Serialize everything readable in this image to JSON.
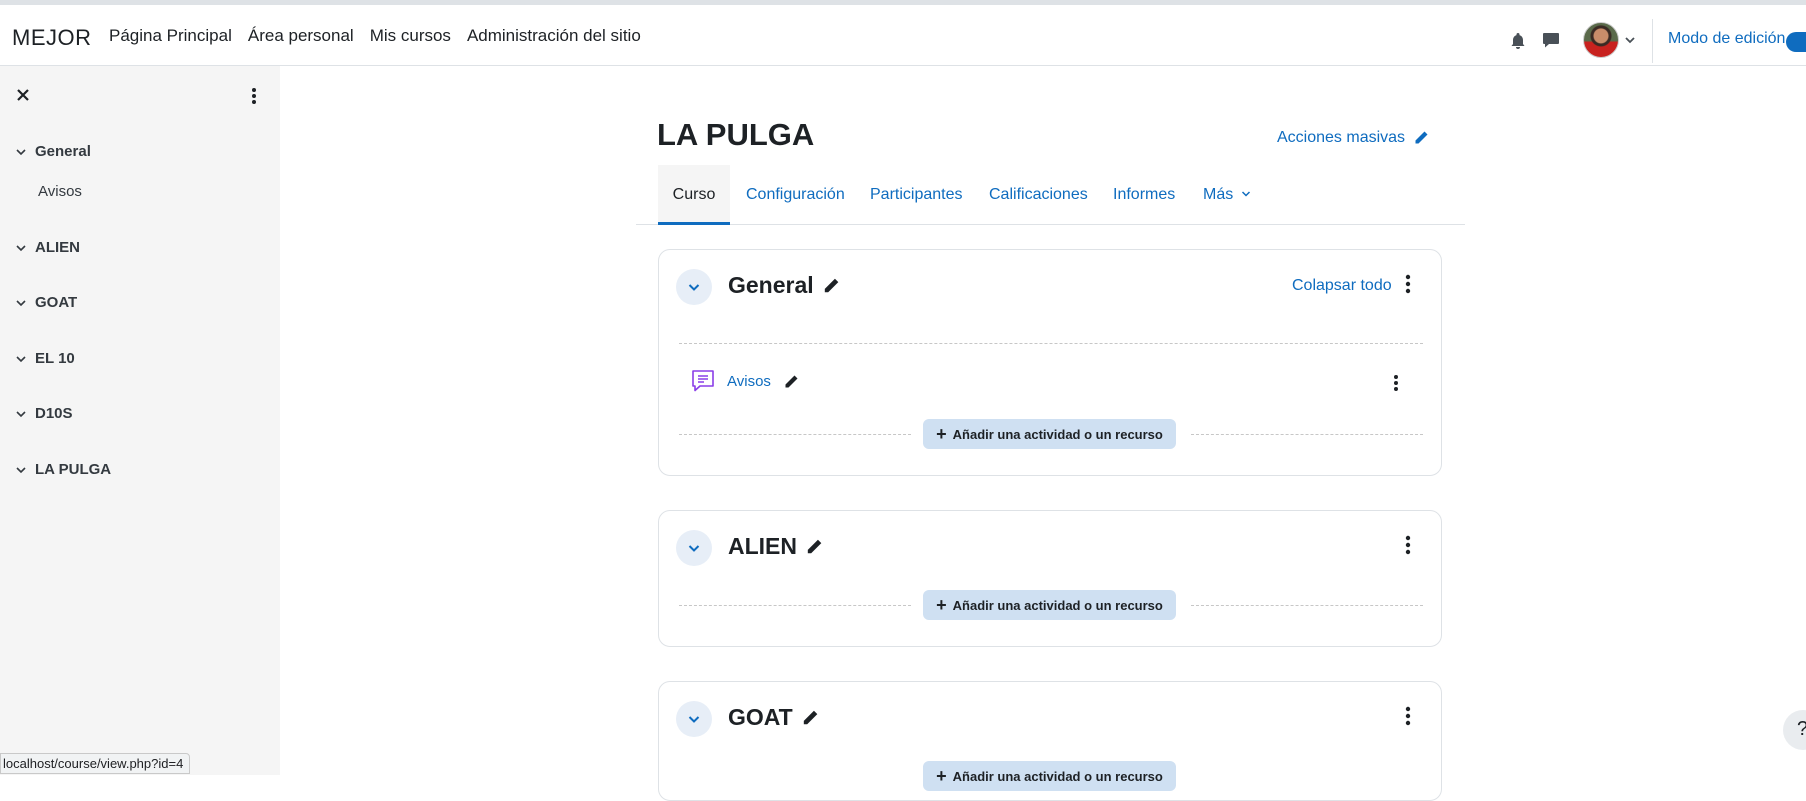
{
  "navbar": {
    "brand": "MEJOR",
    "links": [
      "Página Principal",
      "Área personal",
      "Mis cursos",
      "Administración del sitio"
    ],
    "edit_mode_label": "Modo de edición",
    "icons": [
      "bell-icon",
      "chat-icon",
      "avatar",
      "chevron-down-icon"
    ]
  },
  "sidebar": {
    "sections": [
      {
        "label": "General",
        "items": [
          "Avisos"
        ]
      },
      {
        "label": "ALIEN",
        "items": []
      },
      {
        "label": "GOAT",
        "items": []
      },
      {
        "label": "EL 10",
        "items": []
      },
      {
        "label": "D10S",
        "items": []
      },
      {
        "label": "LA PULGA",
        "items": []
      }
    ]
  },
  "course": {
    "title": "LA PULGA",
    "bulk_actions_label": "Acciones masivas",
    "tabs": [
      "Curso",
      "Configuración",
      "Participantes",
      "Calificaciones",
      "Informes",
      "Más"
    ],
    "active_tab": "Curso"
  },
  "sections": [
    {
      "title": "General",
      "collapse_all_label": "Colapsar todo",
      "activities": [
        {
          "name": "Avisos",
          "icon": "forum-icon"
        }
      ],
      "add_label": "Añadir una actividad o un recurso"
    },
    {
      "title": "ALIEN",
      "activities": [],
      "add_label": "Añadir una actividad o un recurso"
    },
    {
      "title": "GOAT",
      "activities": [],
      "add_label": "Añadir una actividad o un recurso"
    }
  ],
  "status_bar": {
    "url": "localhost/course/view.php?id=4"
  },
  "help_button": {
    "label": "?"
  },
  "colors": {
    "link": "#0f6cbf",
    "sidebar_bg": "#f5f5f5",
    "add_button_bg": "#cfe0f2",
    "forum_icon": "#8a3ee8"
  }
}
